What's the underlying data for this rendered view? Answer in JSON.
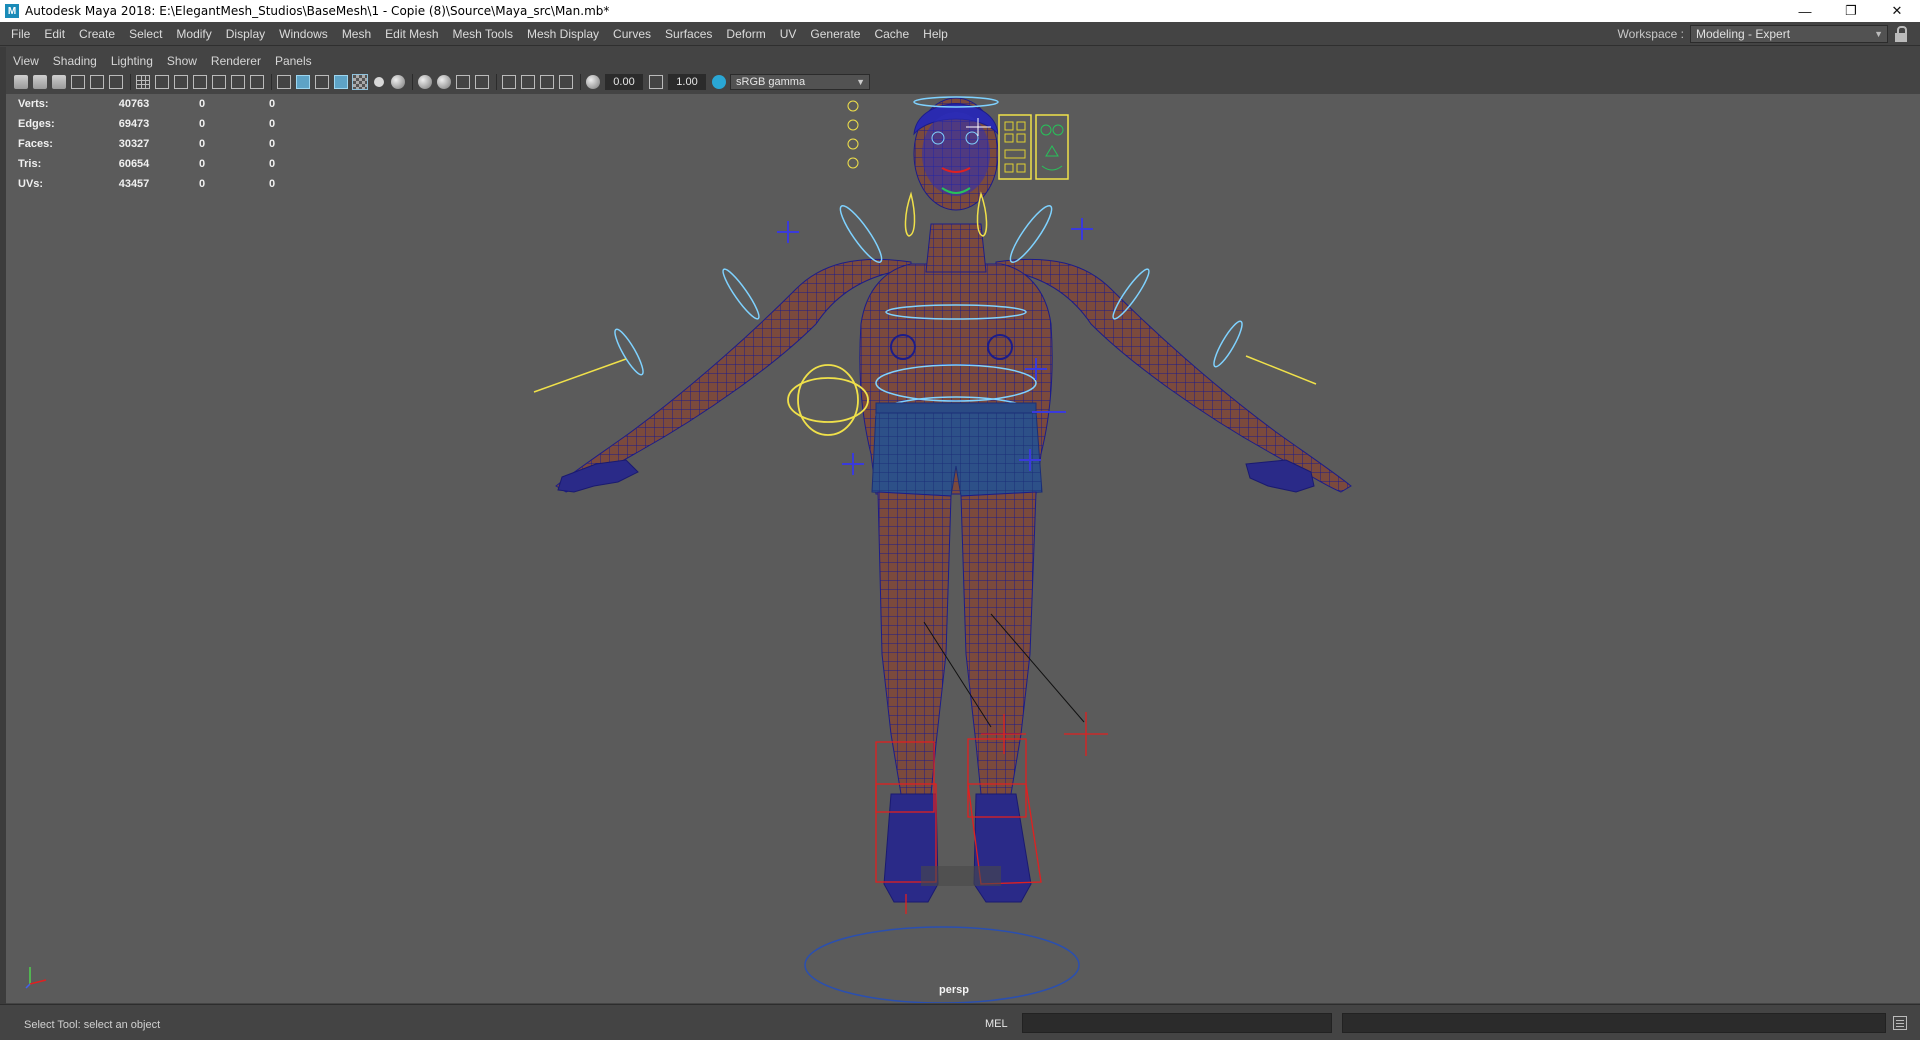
{
  "titlebar": {
    "title": "Autodesk Maya 2018: E:\\ElegantMesh_Studios\\BaseMesh\\1 - Copie (8)\\Source\\Maya_src\\Man.mb*",
    "app_icon_letter": "M",
    "minimize": "—",
    "restore": "❐",
    "close": "✕"
  },
  "menubar": {
    "items": [
      "File",
      "Edit",
      "Create",
      "Select",
      "Modify",
      "Display",
      "Windows",
      "Mesh",
      "Edit Mesh",
      "Mesh Tools",
      "Mesh Display",
      "Curves",
      "Surfaces",
      "Deform",
      "UV",
      "Generate",
      "Cache",
      "Help"
    ]
  },
  "workspace": {
    "label": "Workspace :",
    "value": "Modeling - Expert",
    "arrow": "▼"
  },
  "panelmenu": {
    "items": [
      "View",
      "Shading",
      "Lighting",
      "Show",
      "Renderer",
      "Panels"
    ]
  },
  "paneltools": {
    "exposure": "0.00",
    "gamma": "1.00",
    "color_space": "sRGB gamma",
    "arrow": "▼"
  },
  "hud": {
    "rows": [
      {
        "label": "Verts:",
        "v1": "40763",
        "v2": "0",
        "v3": "0"
      },
      {
        "label": "Edges:",
        "v1": "69473",
        "v2": "0",
        "v3": "0"
      },
      {
        "label": "Faces:",
        "v1": "30327",
        "v2": "0",
        "v3": "0"
      },
      {
        "label": "Tris:",
        "v1": "60654",
        "v2": "0",
        "v3": "0"
      },
      {
        "label": "UVs:",
        "v1": "43457",
        "v2": "0",
        "v3": "0"
      }
    ]
  },
  "viewport": {
    "camera": "persp",
    "colors": {
      "background": "#5b5b5b",
      "skin": "#7a4a3a",
      "wire": "#1a1a8c",
      "shorts": "#2d4f86",
      "control_cyan": "#7fd2ff",
      "control_yellow": "#f0e14a",
      "foot_red": "#e02020",
      "cross_blue": "#3a3adc"
    }
  },
  "statusline": {
    "help": "Select Tool: select an object",
    "mel": "MEL"
  }
}
